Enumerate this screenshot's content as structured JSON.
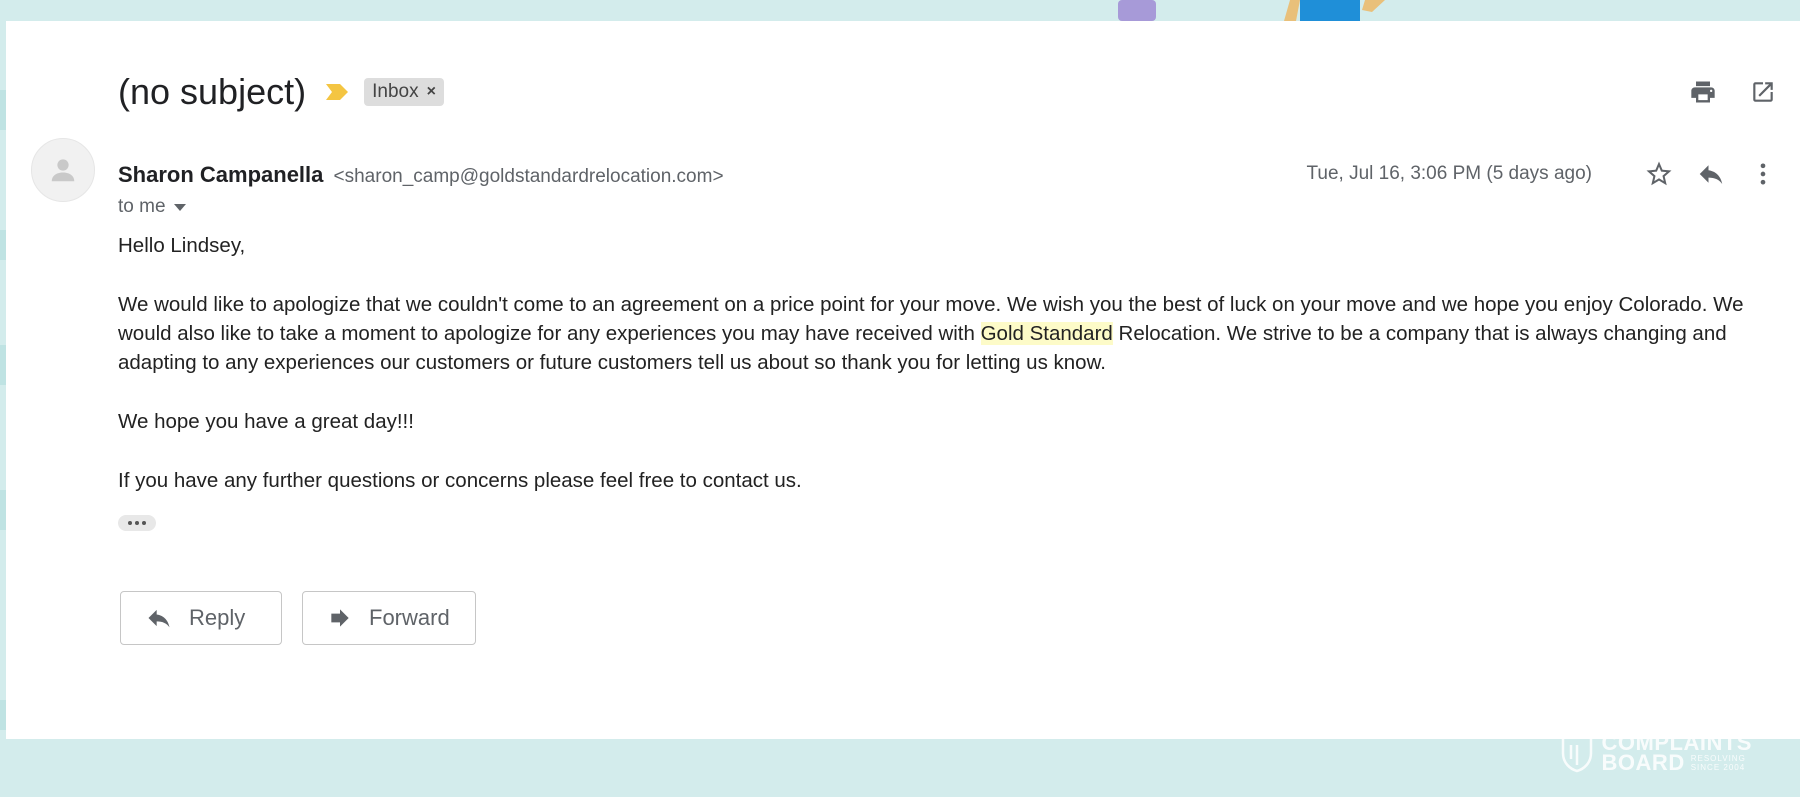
{
  "email": {
    "subject": "(no subject)",
    "label": "Inbox",
    "label_remove": "×",
    "sender_name": "Sharon Campanella",
    "sender_email": "<sharon_camp@goldstandardrelocation.com>",
    "recipient": "to me",
    "date": "Tue, Jul 16, 3:06 PM (5 days ago)",
    "body": {
      "greeting": "Hello Lindsey,",
      "p1_before": "We would like to apologize that we couldn't come to an agreement on a price point for your move. We wish you the best of luck on your move and we hope you enjoy Colorado. We would also like to take a moment to apologize for any experiences you may have received  with ",
      "p1_highlight": "Gold Standard",
      "p1_after": " Relocation. We strive to be a company that is always changing and adapting to any experiences our customers or future customers tell us about so thank you for letting us know.",
      "p2": "We hope you have a great day!!!",
      "p3": "If you have any further questions or concerns please feel free to contact us."
    }
  },
  "actions": {
    "reply_label": "Reply",
    "forward_label": "Forward"
  },
  "watermark": {
    "line1": "COMPLAINTS",
    "line2": "BOARD",
    "tagline1": "RESOLVING",
    "tagline2": "SINCE 2004"
  },
  "colors": {
    "background": "#d3ecec",
    "card": "#ffffff",
    "label_chip": "#dddddd",
    "importance_marker": "#f4c542",
    "highlight": "#fdfbc8"
  }
}
